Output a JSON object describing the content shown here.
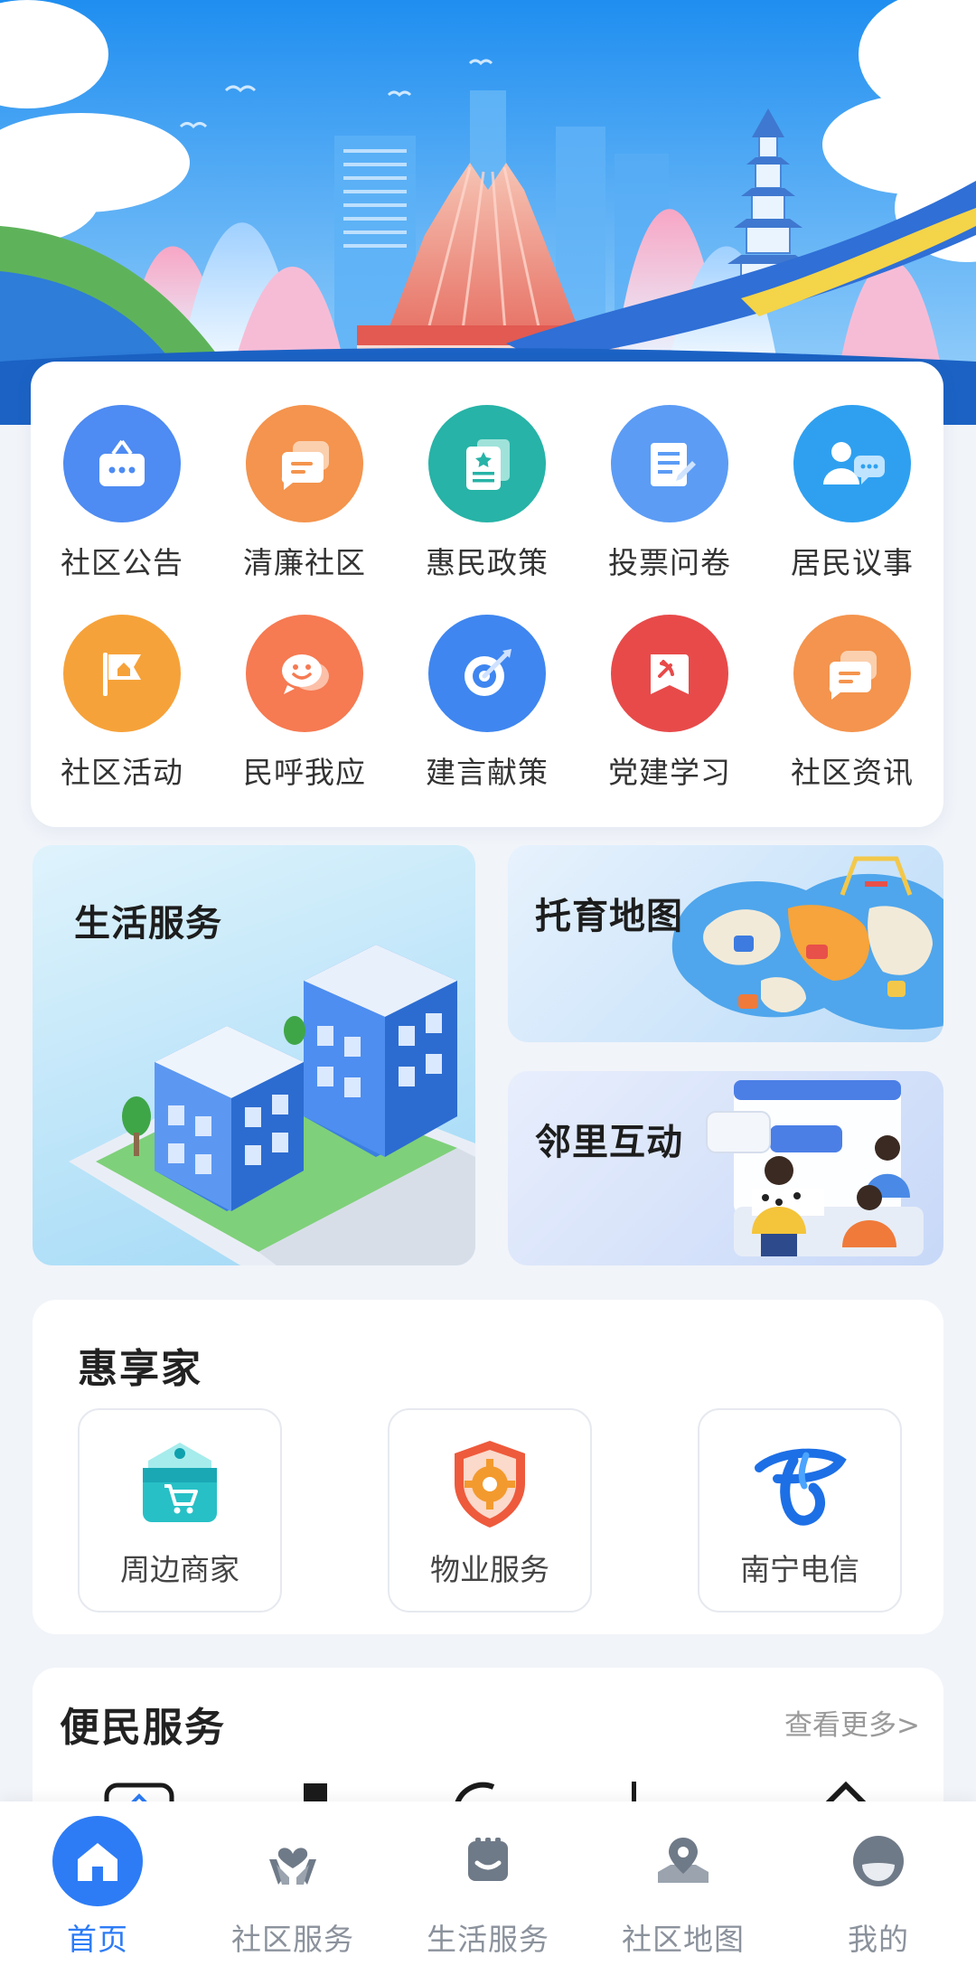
{
  "grid": [
    {
      "label": "社区公告",
      "icon": "notice-board-icon",
      "color": "#4e8bf2"
    },
    {
      "label": "清廉社区",
      "icon": "chat-bubble-icon",
      "color": "#f4944e"
    },
    {
      "label": "惠民政策",
      "icon": "policy-document-icon",
      "color": "#27b3a7"
    },
    {
      "label": "投票问卷",
      "icon": "questionnaire-icon",
      "color": "#5c9cf5"
    },
    {
      "label": "居民议事",
      "icon": "residents-discussion-icon",
      "color": "#2fa0f0"
    },
    {
      "label": "社区活动",
      "icon": "activity-flag-icon",
      "color": "#f6a23a"
    },
    {
      "label": "民呼我应",
      "icon": "smile-chat-icon",
      "color": "#f67a52"
    },
    {
      "label": "建言献策",
      "icon": "target-dart-icon",
      "color": "#3f86f0"
    },
    {
      "label": "党建学习",
      "icon": "party-emblem-icon",
      "color": "#e84a4a"
    },
    {
      "label": "社区资讯",
      "icon": "news-bubble-icon",
      "color": "#f4944e"
    }
  ],
  "tiles": {
    "life_service": "生活服务",
    "childcare_map": "托育地图",
    "neighbor_interaction": "邻里互动"
  },
  "hui": {
    "title": "惠享家",
    "items": [
      {
        "label": "周边商家",
        "icon": "shop-cart-icon"
      },
      {
        "label": "物业服务",
        "icon": "shield-gear-icon"
      },
      {
        "label": "南宁电信",
        "icon": "telecom-logo-icon"
      }
    ]
  },
  "bian": {
    "title": "便民服务",
    "more": "查看更多>"
  },
  "tabs": [
    {
      "label": "首页",
      "icon": "home-icon",
      "active": true
    },
    {
      "label": "社区服务",
      "icon": "heart-hands-icon",
      "active": false
    },
    {
      "label": "生活服务",
      "icon": "life-service-icon",
      "active": false
    },
    {
      "label": "社区地图",
      "icon": "map-pin-icon",
      "active": false
    },
    {
      "label": "我的",
      "icon": "profile-icon",
      "active": false
    }
  ],
  "colors": {
    "accent": "#2d7cf6",
    "background": "#f1f4f9"
  }
}
